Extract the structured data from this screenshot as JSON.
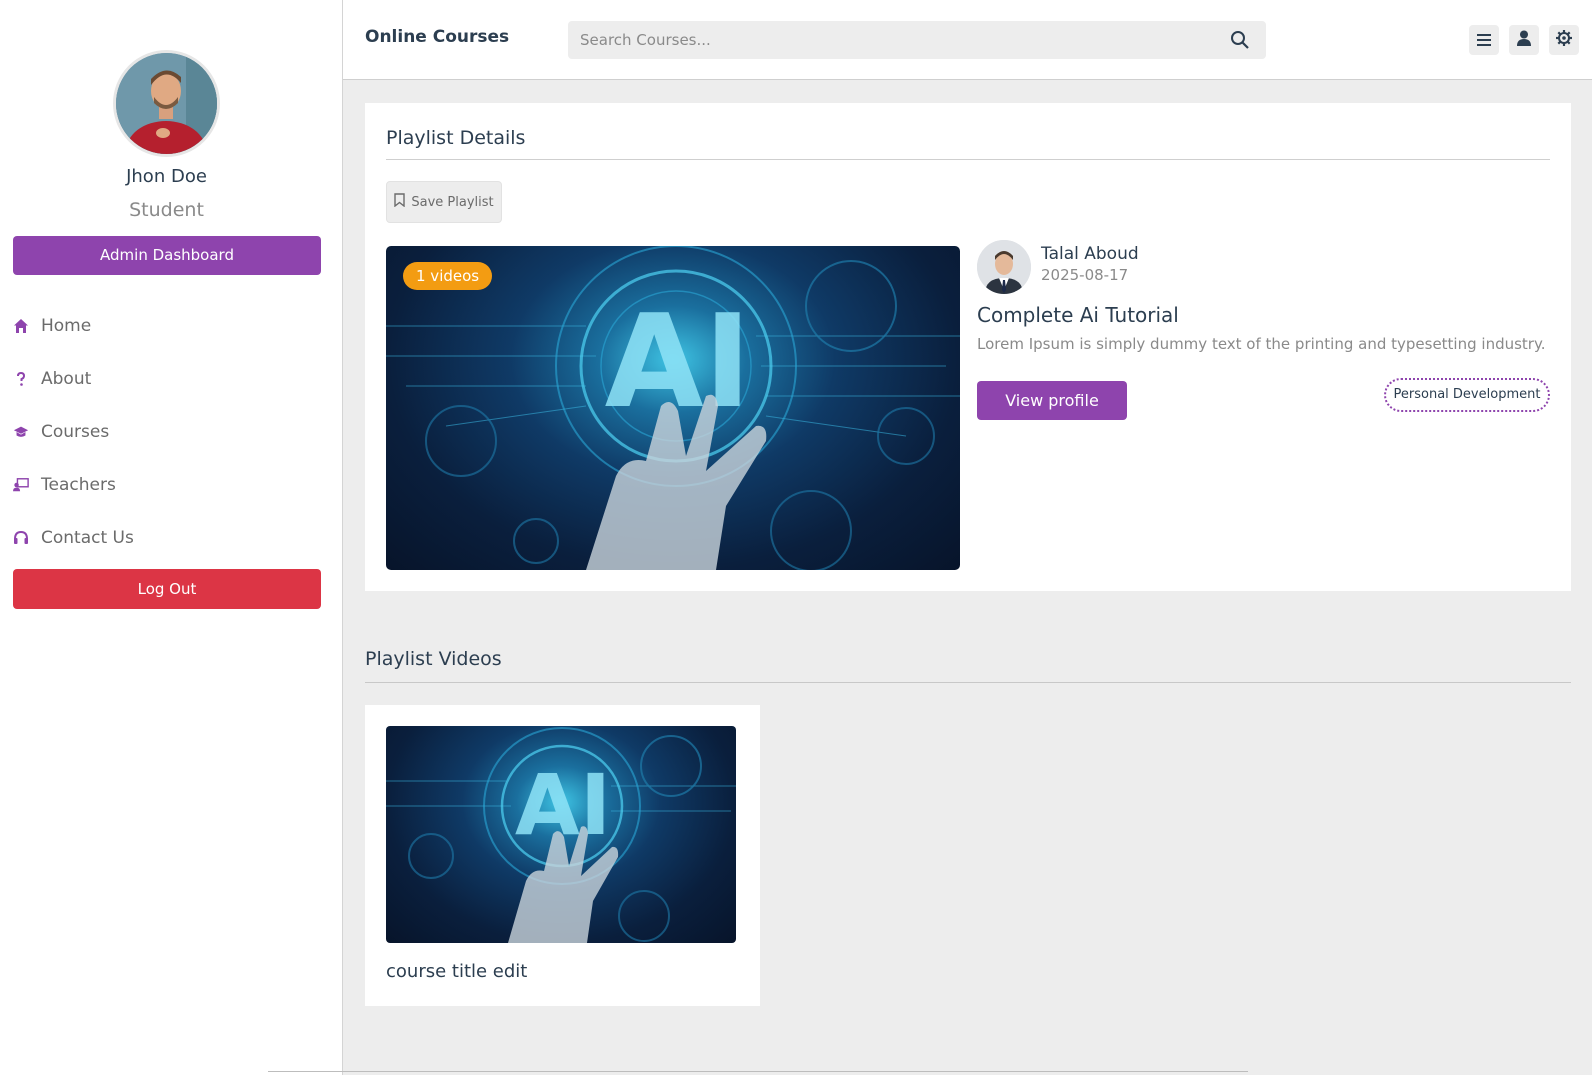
{
  "sidebar": {
    "user_name": "Jhon Doe",
    "user_role": "Student",
    "admin_button": "Admin Dashboard",
    "nav": [
      {
        "label": "Home",
        "icon": "home-icon"
      },
      {
        "label": "About",
        "icon": "question-icon"
      },
      {
        "label": "Courses",
        "icon": "graduation-cap-icon"
      },
      {
        "label": "Teachers",
        "icon": "teacher-icon"
      },
      {
        "label": "Contact Us",
        "icon": "headset-icon"
      }
    ],
    "logout_button": "Log Out"
  },
  "header": {
    "brand": "Online Courses",
    "search_placeholder": "Search Courses..."
  },
  "playlist": {
    "heading": "Playlist Details",
    "save_button": "Save Playlist",
    "video_count_badge": "1 videos",
    "thumbnail_text": "AI",
    "teacher_name": "Talal Aboud",
    "date": "2025-08-17",
    "title": "Complete Ai Tutorial",
    "description": "Lorem Ipsum is simply dummy text of the printing and typesetting industry.",
    "view_profile_button": "View profile",
    "category_tag": "Personal Development"
  },
  "videos": {
    "heading": "Playlist Videos",
    "items": [
      {
        "title": "course title edit",
        "thumbnail_text": "AI"
      }
    ]
  },
  "colors": {
    "accent": "#8e44ad",
    "danger": "#dc3545",
    "badge": "#f39c12",
    "background": "#ededed"
  }
}
